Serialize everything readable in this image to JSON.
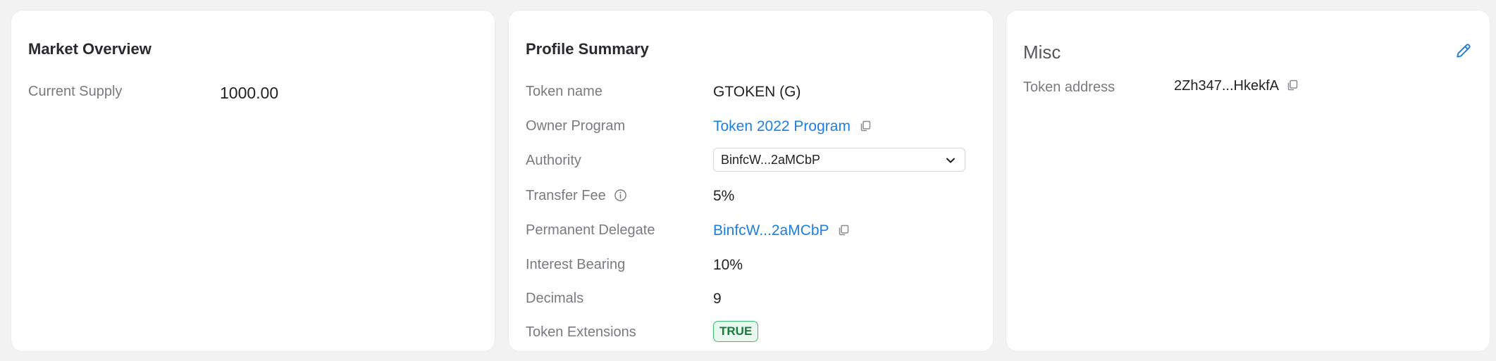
{
  "market": {
    "title": "Market Overview",
    "rows": [
      {
        "label": "Current Supply",
        "value": "1000.00"
      }
    ]
  },
  "profile": {
    "title": "Profile Summary",
    "token_name": {
      "label": "Token name",
      "value": "GTOKEN (G)"
    },
    "owner_program": {
      "label": "Owner Program",
      "value": "Token 2022 Program",
      "icon": "copy-icon"
    },
    "authority": {
      "label": "Authority",
      "selected": "BinfcW...2aMCbP",
      "icon": "chevron-down-icon"
    },
    "transfer_fee": {
      "label": "Transfer Fee",
      "value": "5%",
      "icon": "info-icon"
    },
    "permanent_delegate": {
      "label": "Permanent Delegate",
      "value": "BinfcW...2aMCbP",
      "icon": "copy-icon"
    },
    "interest_bearing": {
      "label": "Interest Bearing",
      "value": "10%"
    },
    "decimals": {
      "label": "Decimals",
      "value": "9"
    },
    "token_extensions": {
      "label": "Token Extensions",
      "badge": "TRUE"
    }
  },
  "misc": {
    "title": "Misc",
    "edit_icon": "pencil-icon",
    "token_address": {
      "label": "Token address",
      "value": "2Zh347...HkekfA",
      "icon": "copy-icon"
    }
  },
  "colors": {
    "link": "#1d7fe0",
    "badge_border": "#3cbc6d",
    "badge_bg": "#e9f8ee",
    "badge_text": "#197a3c",
    "label": "#7a7a80"
  }
}
